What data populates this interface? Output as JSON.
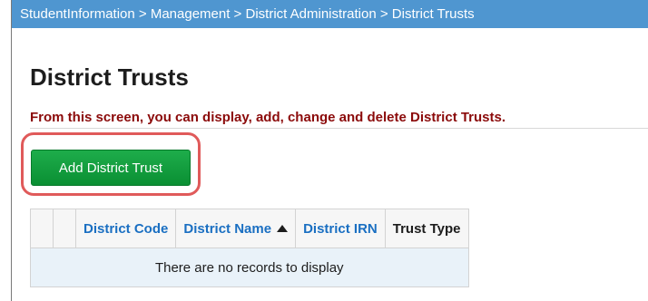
{
  "breadcrumb": {
    "text": "StudentInformation > Management > District Administration > District Trusts"
  },
  "page": {
    "title": "District Trusts",
    "subtitle": "From this screen, you can display, add, change and delete District Trusts."
  },
  "toolbar": {
    "add_label": "Add District Trust"
  },
  "table": {
    "columns": [
      "District Code",
      "District Name",
      "District IRN",
      "Trust Type"
    ],
    "sorted_column": "District Name",
    "sort_direction": "ascending",
    "empty_message": "There are no records to display"
  },
  "colors": {
    "breadcrumb_bg": "#4f96d0",
    "subtitle": "#8b0a0a",
    "button": "#0a8f33",
    "highlight": "#e05a5a",
    "link": "#1a6fc2"
  }
}
